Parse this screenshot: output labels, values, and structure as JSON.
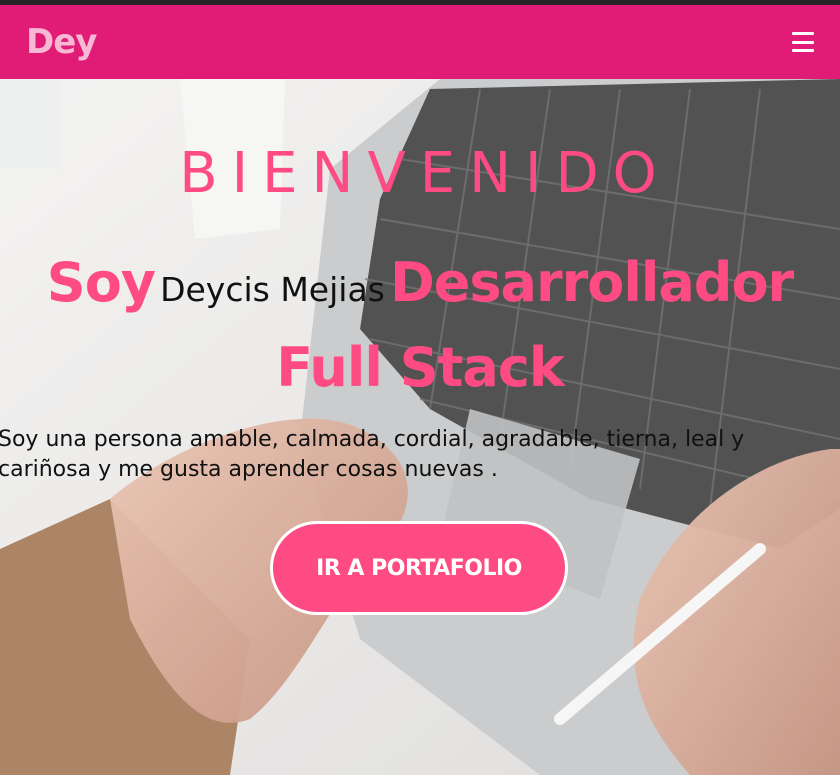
{
  "navbar": {
    "brand": "Dey",
    "menu_icon": "hamburger-icon"
  },
  "hero": {
    "title": "BIENVENIDO",
    "headline_prefix": "Soy",
    "name": "Deycis Mejias",
    "role": "Desarrollador Full Stack",
    "description": "Soy una persona amable, calmada, cordial, agradable, tierna, leal y cariñosa y me gusta aprender cosas nuevas .",
    "cta_label": "IR A PORTAFOLIO"
  },
  "colors": {
    "navbar_bg": "#e01c76",
    "accent_pink": "#ff4b84",
    "brand_text": "#f7b8d3"
  }
}
